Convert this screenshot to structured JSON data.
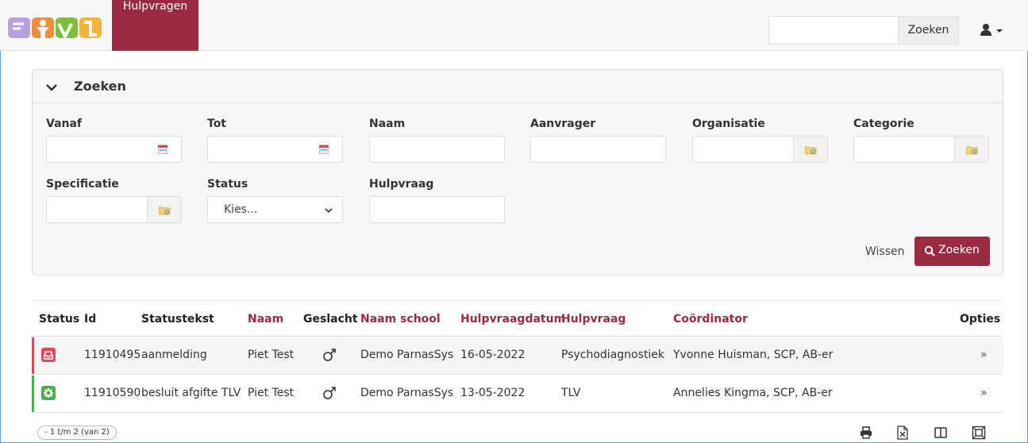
{
  "navbar": {
    "tab_label": "Hulpvragen",
    "search_button": "Zoeken",
    "search_value": ""
  },
  "search_panel": {
    "title": "Zoeken",
    "fields": {
      "vanaf": "Vanaf",
      "tot": "Tot",
      "naam": "Naam",
      "aanvrager": "Aanvrager",
      "organisatie": "Organisatie",
      "categorie": "Categorie",
      "specificatie": "Specificatie",
      "status": "Status",
      "hulpvraag": "Hulpvraag"
    },
    "status_selected": "Kies...",
    "clear_label": "Wissen",
    "search_label": "Zoeken"
  },
  "table": {
    "headers": {
      "status": "Status",
      "id": "Id",
      "statustekst": "Statustekst",
      "naam": "Naam",
      "geslacht": "Geslacht",
      "naam_school": "Naam school",
      "hulpvraagdatum": "Hulpvraagdatum",
      "hulpvraag": "Hulpvraag",
      "coordinator": "Coördinator",
      "opties": "Opties"
    },
    "rows": [
      {
        "status_color": "#e3485a",
        "status_icon": "inbox-icon",
        "id": "11910495",
        "statustekst": "aanmelding",
        "naam": "Piet Test",
        "geslacht": "♂",
        "naam_school": "Demo ParnasSys",
        "hulpvraagdatum": "16-05-2022",
        "hulpvraag": "Psychodiagnostiek",
        "coordinator": "Yvonne Huisman, SCP, AB-er",
        "opties": "»"
      },
      {
        "status_color": "#4cae4c",
        "status_icon": "gear-icon",
        "id": "11910590",
        "statustekst": "besluit afgifte TLV",
        "naam": "Piet Test",
        "geslacht": "♂",
        "naam_school": "Demo ParnasSys",
        "hulpvraagdatum": "13-05-2022",
        "hulpvraag": "TLV",
        "coordinator": "Annelies Kingma, SCP, AB-er",
        "opties": "»"
      }
    ]
  },
  "footer": {
    "pager": "- 1 t/m 2 (van 2)",
    "tools": [
      "print-icon",
      "excel-icon",
      "columns-icon",
      "fullscreen-icon"
    ]
  },
  "colors": {
    "brand": "#9a2a42",
    "status_red": "#e3485a",
    "status_green": "#4cae4c"
  }
}
